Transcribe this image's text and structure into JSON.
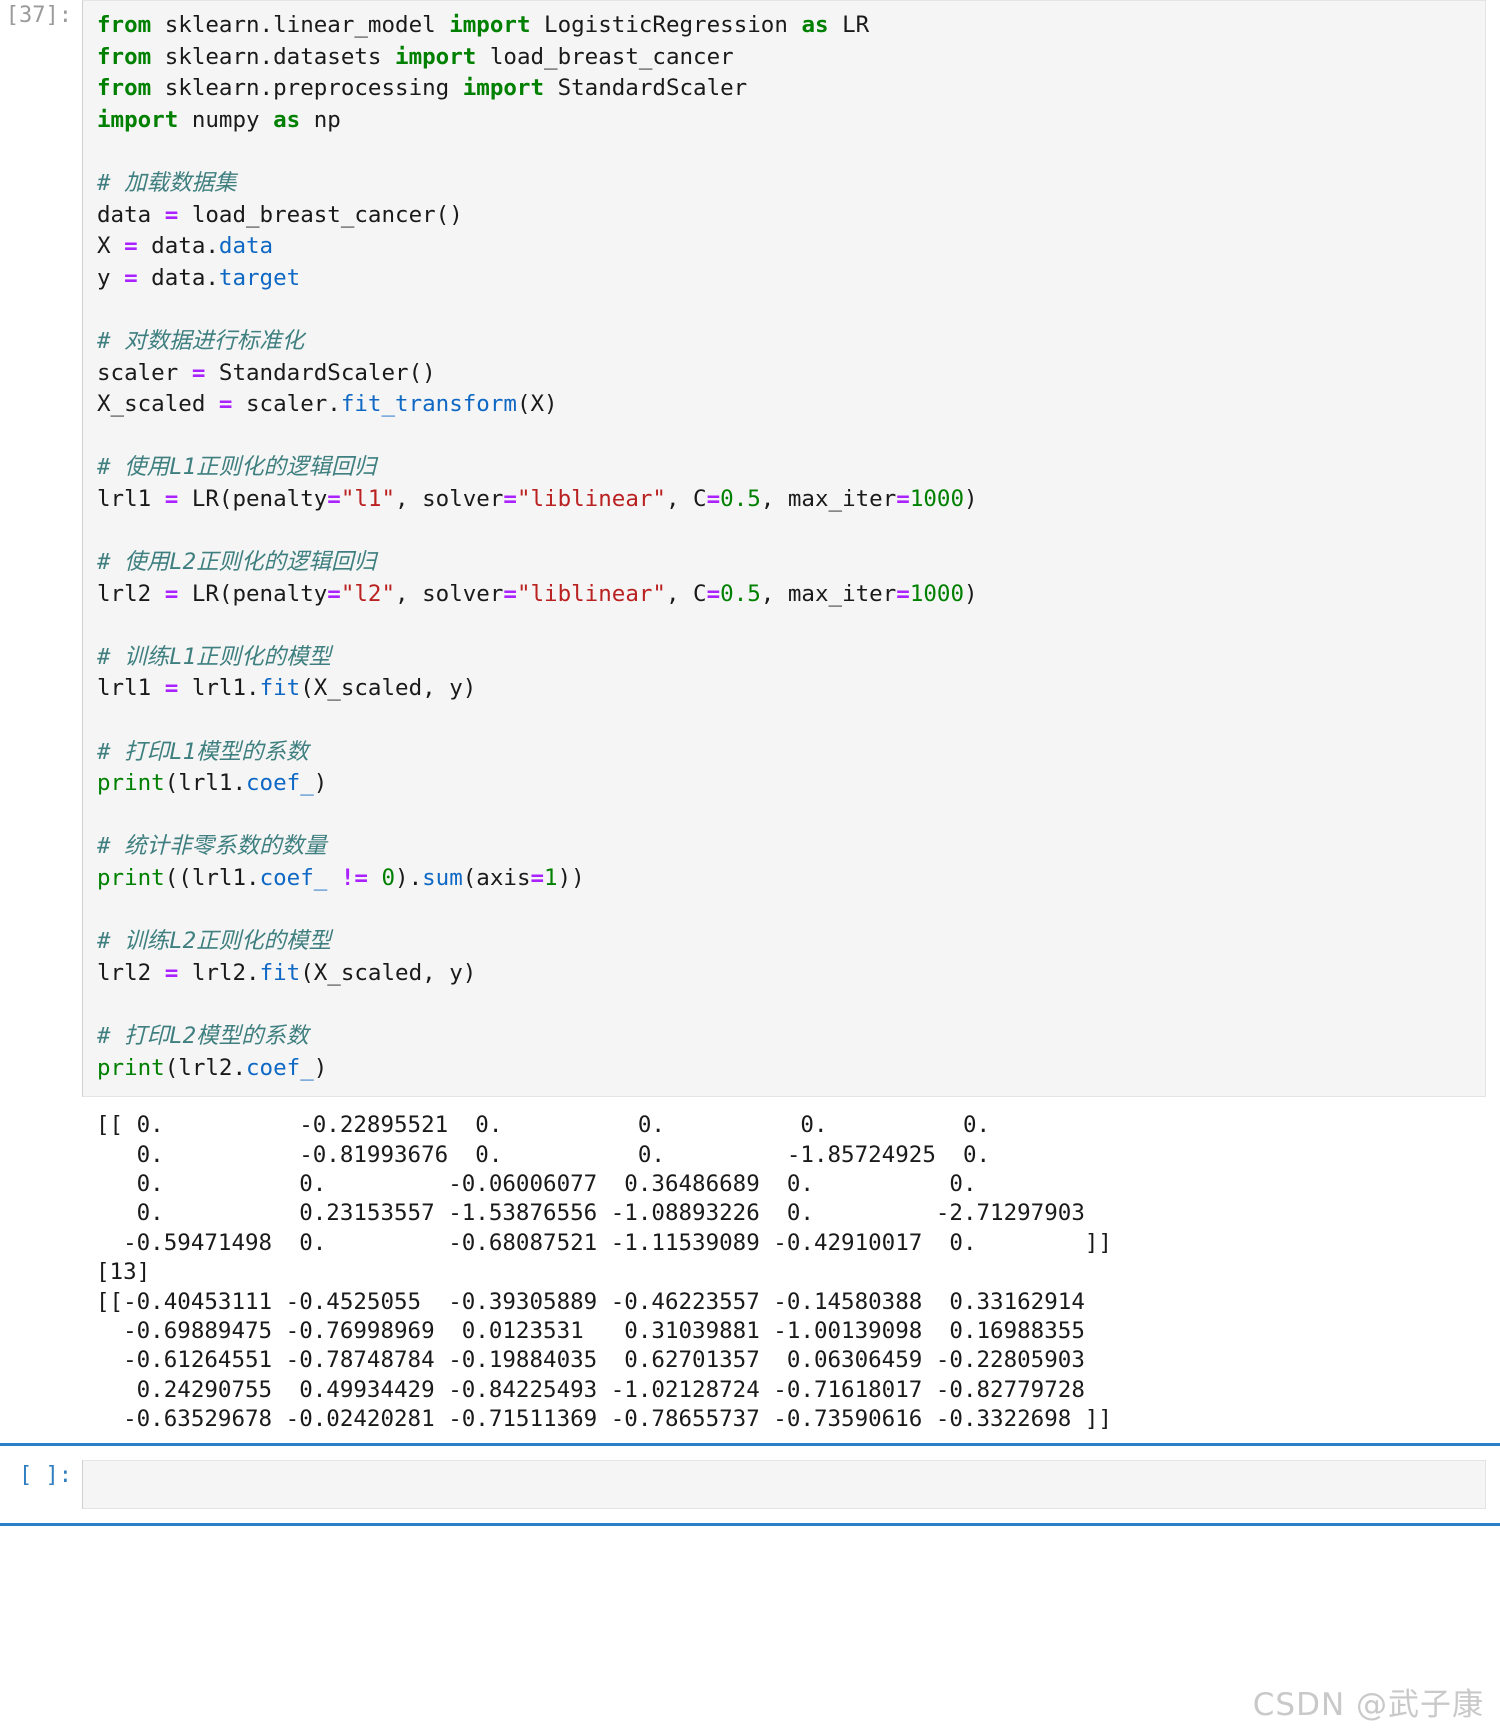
{
  "notebook": {
    "cells": [
      {
        "prompt": "[37]:",
        "code_lines": [
          [
            {
              "t": "from ",
              "c": "kw"
            },
            {
              "t": "sklearn.linear_model ",
              "c": "pl"
            },
            {
              "t": "import ",
              "c": "kw"
            },
            {
              "t": "LogisticRegression ",
              "c": "pl"
            },
            {
              "t": "as",
              "c": "kw"
            },
            {
              "t": " LR",
              "c": "pl"
            }
          ],
          [
            {
              "t": "from ",
              "c": "kw"
            },
            {
              "t": "sklearn.datasets ",
              "c": "pl"
            },
            {
              "t": "import ",
              "c": "kw"
            },
            {
              "t": "load_breast_cancer",
              "c": "pl"
            }
          ],
          [
            {
              "t": "from ",
              "c": "kw"
            },
            {
              "t": "sklearn.preprocessing ",
              "c": "pl"
            },
            {
              "t": "import ",
              "c": "kw"
            },
            {
              "t": "StandardScaler",
              "c": "pl"
            }
          ],
          [
            {
              "t": "import ",
              "c": "kw"
            },
            {
              "t": "numpy ",
              "c": "pl"
            },
            {
              "t": "as",
              "c": "kw"
            },
            {
              "t": " np",
              "c": "pl"
            }
          ],
          [],
          [
            {
              "t": "# 加载数据集",
              "c": "cm"
            }
          ],
          [
            {
              "t": "data ",
              "c": "pl"
            },
            {
              "t": "=",
              "c": "op"
            },
            {
              "t": " load_breast_cancer()",
              "c": "pl"
            }
          ],
          [
            {
              "t": "X ",
              "c": "pl"
            },
            {
              "t": "=",
              "c": "op"
            },
            {
              "t": " data.",
              "c": "pl"
            },
            {
              "t": "data",
              "c": "at"
            }
          ],
          [
            {
              "t": "y ",
              "c": "pl"
            },
            {
              "t": "=",
              "c": "op"
            },
            {
              "t": " data.",
              "c": "pl"
            },
            {
              "t": "target",
              "c": "at"
            }
          ],
          [],
          [
            {
              "t": "# 对数据进行标准化",
              "c": "cm"
            }
          ],
          [
            {
              "t": "scaler ",
              "c": "pl"
            },
            {
              "t": "=",
              "c": "op"
            },
            {
              "t": " StandardScaler()",
              "c": "pl"
            }
          ],
          [
            {
              "t": "X_scaled ",
              "c": "pl"
            },
            {
              "t": "=",
              "c": "op"
            },
            {
              "t": " scaler.",
              "c": "pl"
            },
            {
              "t": "fit_transform",
              "c": "at"
            },
            {
              "t": "(X)",
              "c": "pl"
            }
          ],
          [],
          [
            {
              "t": "# 使用L1正则化的逻辑回归",
              "c": "cm"
            }
          ],
          [
            {
              "t": "lrl1 ",
              "c": "pl"
            },
            {
              "t": "=",
              "c": "op"
            },
            {
              "t": " LR(penalty",
              "c": "pl"
            },
            {
              "t": "=",
              "c": "op"
            },
            {
              "t": "\"l1\"",
              "c": "st"
            },
            {
              "t": ", solver",
              "c": "pl"
            },
            {
              "t": "=",
              "c": "op"
            },
            {
              "t": "\"liblinear\"",
              "c": "st"
            },
            {
              "t": ", C",
              "c": "pl"
            },
            {
              "t": "=",
              "c": "op"
            },
            {
              "t": "0.5",
              "c": "nu"
            },
            {
              "t": ", max_iter",
              "c": "pl"
            },
            {
              "t": "=",
              "c": "op"
            },
            {
              "t": "1000",
              "c": "nu"
            },
            {
              "t": ")",
              "c": "pl"
            }
          ],
          [],
          [
            {
              "t": "# 使用L2正则化的逻辑回归",
              "c": "cm"
            }
          ],
          [
            {
              "t": "lrl2 ",
              "c": "pl"
            },
            {
              "t": "=",
              "c": "op"
            },
            {
              "t": " LR(penalty",
              "c": "pl"
            },
            {
              "t": "=",
              "c": "op"
            },
            {
              "t": "\"l2\"",
              "c": "st"
            },
            {
              "t": ", solver",
              "c": "pl"
            },
            {
              "t": "=",
              "c": "op"
            },
            {
              "t": "\"liblinear\"",
              "c": "st"
            },
            {
              "t": ", C",
              "c": "pl"
            },
            {
              "t": "=",
              "c": "op"
            },
            {
              "t": "0.5",
              "c": "nu"
            },
            {
              "t": ", max_iter",
              "c": "pl"
            },
            {
              "t": "=",
              "c": "op"
            },
            {
              "t": "1000",
              "c": "nu"
            },
            {
              "t": ")",
              "c": "pl"
            }
          ],
          [],
          [
            {
              "t": "# 训练L1正则化的模型",
              "c": "cm"
            }
          ],
          [
            {
              "t": "lrl1 ",
              "c": "pl"
            },
            {
              "t": "=",
              "c": "op"
            },
            {
              "t": " lrl1.",
              "c": "pl"
            },
            {
              "t": "fit",
              "c": "at"
            },
            {
              "t": "(X_scaled, y)",
              "c": "pl"
            }
          ],
          [],
          [
            {
              "t": "# 打印L1模型的系数",
              "c": "cm"
            }
          ],
          [
            {
              "t": "print",
              "c": "bi"
            },
            {
              "t": "(lrl1.",
              "c": "pl"
            },
            {
              "t": "coef_",
              "c": "at"
            },
            {
              "t": ")",
              "c": "pl"
            }
          ],
          [],
          [
            {
              "t": "# 统计非零系数的数量",
              "c": "cm"
            }
          ],
          [
            {
              "t": "print",
              "c": "bi"
            },
            {
              "t": "((lrl1.",
              "c": "pl"
            },
            {
              "t": "coef_",
              "c": "at"
            },
            {
              "t": " ",
              "c": "pl"
            },
            {
              "t": "!=",
              "c": "op"
            },
            {
              "t": " ",
              "c": "pl"
            },
            {
              "t": "0",
              "c": "nu"
            },
            {
              "t": ").",
              "c": "pl"
            },
            {
              "t": "sum",
              "c": "at"
            },
            {
              "t": "(axis",
              "c": "pl"
            },
            {
              "t": "=",
              "c": "op"
            },
            {
              "t": "1",
              "c": "nu"
            },
            {
              "t": "))",
              "c": "pl"
            }
          ],
          [],
          [
            {
              "t": "# 训练L2正则化的模型",
              "c": "cm"
            }
          ],
          [
            {
              "t": "lrl2 ",
              "c": "pl"
            },
            {
              "t": "=",
              "c": "op"
            },
            {
              "t": " lrl2.",
              "c": "pl"
            },
            {
              "t": "fit",
              "c": "at"
            },
            {
              "t": "(X_scaled, y)",
              "c": "pl"
            }
          ],
          [],
          [
            {
              "t": "# 打印L2模型的系数",
              "c": "cm"
            }
          ],
          [
            {
              "t": "print",
              "c": "bi"
            },
            {
              "t": "(lrl2.",
              "c": "pl"
            },
            {
              "t": "coef_",
              "c": "at"
            },
            {
              "t": ")",
              "c": "pl"
            }
          ]
        ],
        "output_text": "[[ 0.          -0.22895521  0.          0.          0.          0.\n   0.          -0.81993676  0.          0.         -1.85724925  0.\n   0.          0.         -0.06006077  0.36486689  0.          0.\n   0.          0.23153557 -1.53876556 -1.08893226  0.         -2.71297903\n  -0.59471498  0.         -0.68087521 -1.11539089 -0.42910017  0.        ]]\n[13]\n[[-0.40453111 -0.4525055  -0.39305889 -0.46223557 -0.14580388  0.33162914\n  -0.69889475 -0.76998969  0.0123531   0.31039881 -1.00139098  0.16988355\n  -0.61264551 -0.78748784 -0.19884035  0.62701357  0.06306459 -0.22805903\n   0.24290755  0.49934429 -0.84225493 -1.02128724 -0.71618017 -0.82779728\n  -0.63529678 -0.02420281 -0.71511369 -0.78655737 -0.73590616 -0.3322698 ]]"
      },
      {
        "prompt": "[ ]:",
        "code_lines": [],
        "output_text": ""
      }
    ]
  },
  "watermark": {
    "text": "CSDN @武子康"
  },
  "colors": {
    "keyword": "#008000",
    "comment": "#3f7f7f",
    "string": "#ba2121",
    "number": "#008000",
    "operator": "#aa22ff",
    "attribute": "#0f68c4",
    "prompt_gray": "#9b9b9b",
    "prompt_blue": "#307fc1",
    "rule_blue": "#2a7fc9",
    "cell_bg": "#f5f5f5"
  }
}
